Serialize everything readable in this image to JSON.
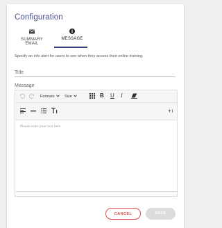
{
  "dialog": {
    "title": "Configuration",
    "tabs": [
      {
        "label": "SUMMARY EMAIL",
        "icon": "envelope-icon"
      },
      {
        "label": "MESSAGE",
        "icon": "info-icon"
      }
    ],
    "active_tab": "MESSAGE",
    "description": "Specify an info alert for users to see when they access their online training.",
    "title_field": {
      "label": "Title",
      "value": ""
    },
    "message_field": {
      "label": "Message"
    },
    "toolbar": {
      "formats_label": "Formats",
      "size_label": "Size"
    },
    "editor": {
      "placeholder": "Please enter your text here"
    },
    "buttons": {
      "cancel": "CANCEL",
      "save": "SAVE"
    }
  },
  "colors": {
    "accent": "#3d3f7a",
    "title": "#4a4f8e",
    "cancel": "#d94a4a",
    "disabled": "#dcdcdc"
  }
}
